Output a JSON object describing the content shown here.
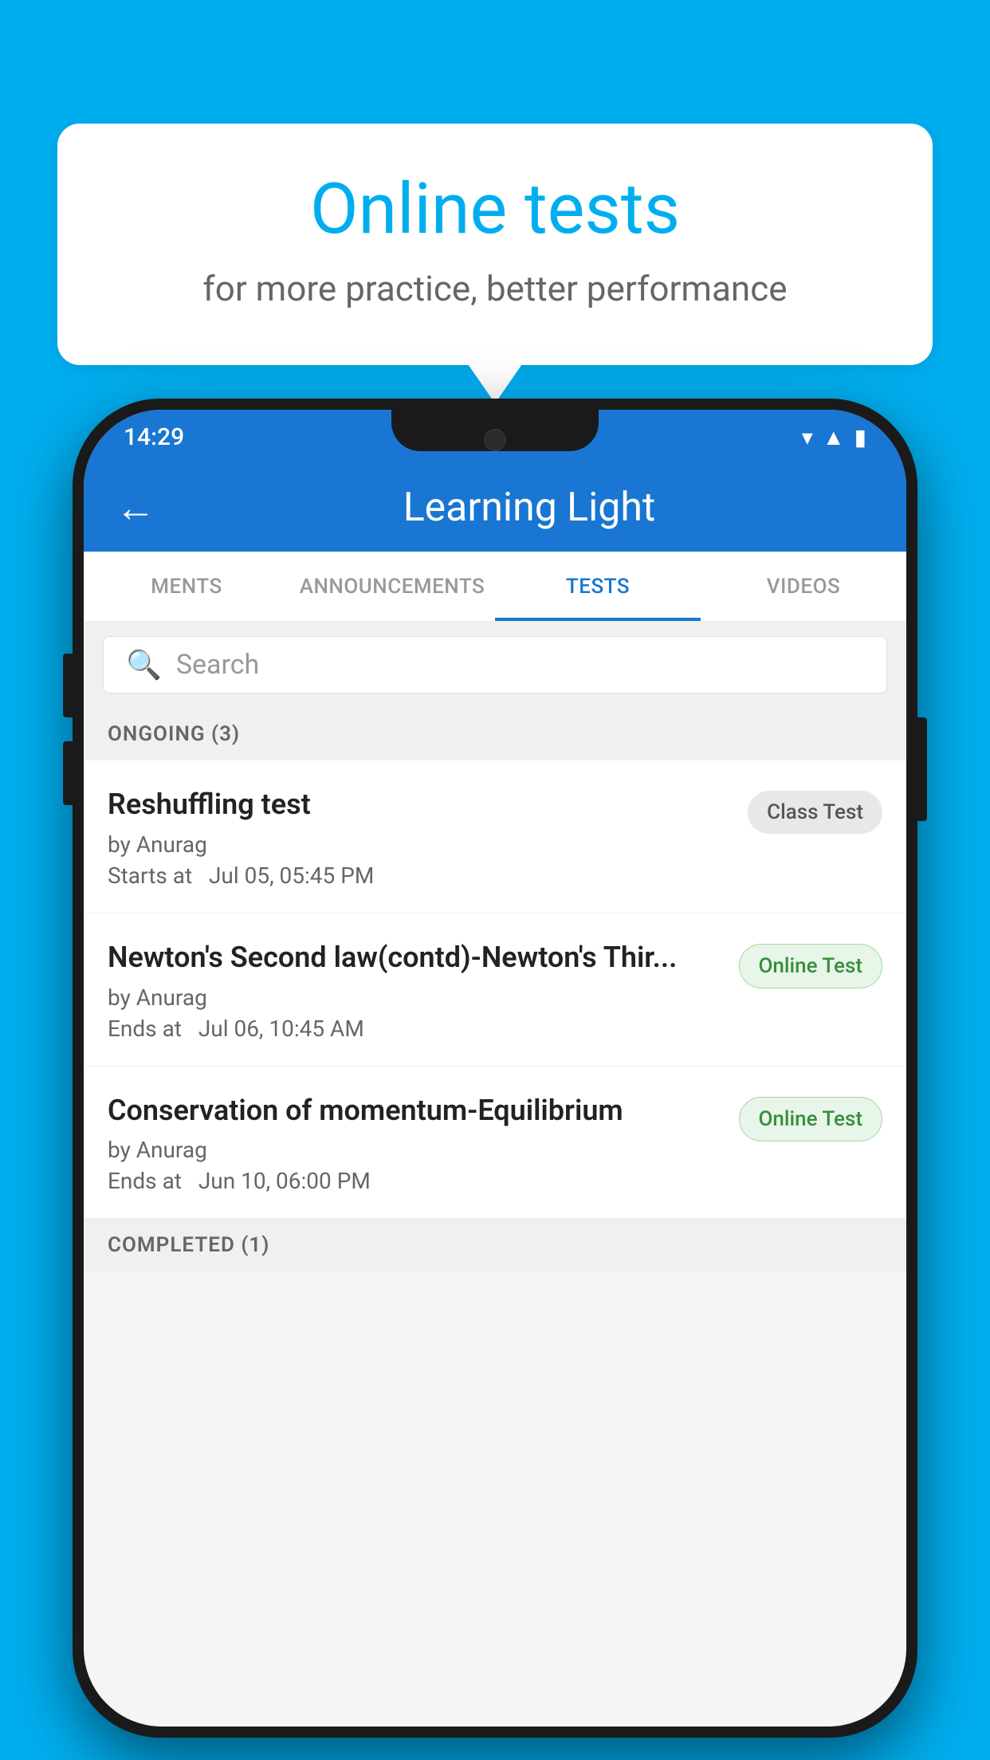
{
  "background": {
    "color": "#00AEEF"
  },
  "speech_bubble": {
    "title": "Online tests",
    "subtitle": "for more practice, better performance"
  },
  "phone": {
    "status_bar": {
      "time": "14:29",
      "icons": [
        "wifi",
        "signal",
        "battery"
      ]
    },
    "app_bar": {
      "back_label": "←",
      "title": "Learning Light"
    },
    "tabs": [
      {
        "label": "MENTS",
        "active": false
      },
      {
        "label": "ANNOUNCEMENTS",
        "active": false
      },
      {
        "label": "TESTS",
        "active": true
      },
      {
        "label": "VIDEOS",
        "active": false
      }
    ],
    "search": {
      "placeholder": "Search",
      "icon": "🔍"
    },
    "ongoing_section": {
      "label": "ONGOING (3)",
      "tests": [
        {
          "name": "Reshuffling test",
          "author": "by Anurag",
          "time_label": "Starts at",
          "time": "Jul 05, 05:45 PM",
          "badge": "Class Test",
          "badge_type": "class"
        },
        {
          "name": "Newton's Second law(contd)-Newton's Thir...",
          "author": "by Anurag",
          "time_label": "Ends at",
          "time": "Jul 06, 10:45 AM",
          "badge": "Online Test",
          "badge_type": "online"
        },
        {
          "name": "Conservation of momentum-Equilibrium",
          "author": "by Anurag",
          "time_label": "Ends at",
          "time": "Jun 10, 06:00 PM",
          "badge": "Online Test",
          "badge_type": "online"
        }
      ]
    },
    "completed_section": {
      "label": "COMPLETED (1)"
    }
  }
}
